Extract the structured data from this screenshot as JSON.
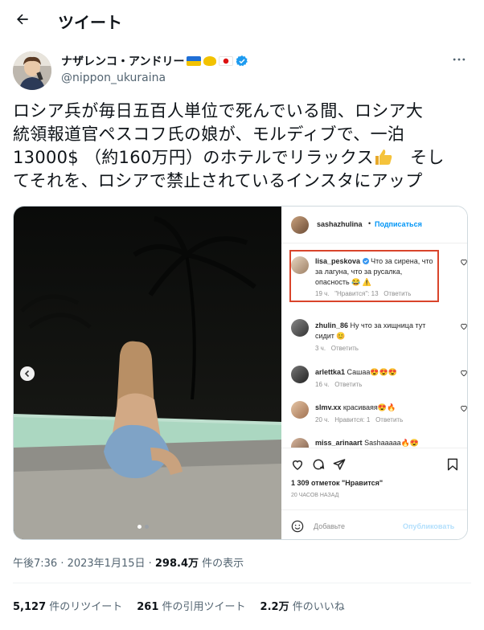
{
  "header": {
    "title": "ツイート"
  },
  "author": {
    "name": "ナザレンコ・アンドリー",
    "handle": "@nippon_ukuraina"
  },
  "tweet": {
    "text_line1": "ロシア兵が毎日五百人単位で死んでいる間、ロシア大",
    "text_line2": "統領報道官ペスコフ氏の娘が、モルディブで、一泊",
    "text_line3a": "13000$ （約160万円）のホテルでリラックス",
    "text_line3b": "　そし",
    "text_line4": "てそれを、ロシアで禁止されているインスタにアップ"
  },
  "instagram": {
    "post_user": "sashazhulina",
    "follow": "Подписаться",
    "comments": [
      {
        "user": "lisa_peskova",
        "text": "Что за сирена, что за лагуна, что за русалка, опасность 😂 ⚠️",
        "time": "19 ч.",
        "likes": "\"Нравится\": 13",
        "reply": "Ответить"
      },
      {
        "user": "zhulin_86",
        "text": "Ну что за хищница тут сидит 😊",
        "time": "3 ч.",
        "likes": "",
        "reply": "Ответить"
      },
      {
        "user": "arlettka1",
        "text": "Сашаа😍😍😍",
        "time": "16 ч.",
        "likes": "",
        "reply": "Ответить"
      },
      {
        "user": "slmv.xx",
        "text": "красиваяя😍🔥",
        "time": "20 ч.",
        "likes": "Нравится: 1",
        "reply": "Ответить"
      },
      {
        "user": "miss_arinaart",
        "text": "Sashaaaaa🔥😍",
        "time": "",
        "likes": "",
        "reply": ""
      }
    ],
    "likes_count": "1 309 отметок \"Нравится\"",
    "ago": "20 ЧАСОВ НАЗАД",
    "add_comment": "Добавьте",
    "post_button": "Опубликовать"
  },
  "meta": {
    "time": "午後7:36 · 2023年1月15日 · ",
    "views": "298.4万",
    "views_label": " 件の表示"
  },
  "stats": {
    "retweets": "5,127",
    "retweets_label": " 件のリツイート",
    "quotes": "261",
    "quotes_label": " 件の引用ツイート",
    "likes": "2.2万",
    "likes_label": " 件のいいね"
  },
  "colors": {
    "verified": "#1d9bf0",
    "highlight": "#d9442b",
    "ig_link": "#0095f6"
  }
}
